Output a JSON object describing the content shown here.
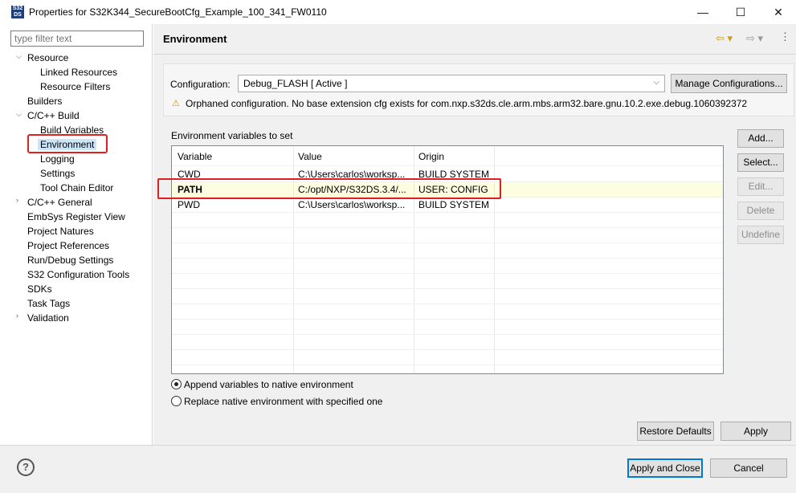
{
  "window": {
    "icon_text": "S32 DS",
    "title": "Properties for S32K344_SecureBootCfg_Example_100_341_FW0110",
    "minimize": "—",
    "maximize": "☐",
    "close": "✕"
  },
  "sidebar": {
    "filter_placeholder": "type filter text",
    "items": [
      {
        "label": "Resource",
        "arrow": "v"
      },
      {
        "label": "Linked Resources"
      },
      {
        "label": "Resource Filters"
      },
      {
        "label": "Builders"
      },
      {
        "label": "C/C++ Build",
        "arrow": "v"
      },
      {
        "label": "Build Variables"
      },
      {
        "label": "Environment"
      },
      {
        "label": "Logging"
      },
      {
        "label": "Settings"
      },
      {
        "label": "Tool Chain Editor"
      },
      {
        "label": "C/C++ General",
        "arrow": ">"
      },
      {
        "label": "EmbSys Register View"
      },
      {
        "label": "Project Natures"
      },
      {
        "label": "Project References"
      },
      {
        "label": "Run/Debug Settings"
      },
      {
        "label": "S32 Configuration Tools"
      },
      {
        "label": "SDKs"
      },
      {
        "label": "Task Tags"
      },
      {
        "label": "Validation",
        "arrow": ">"
      }
    ]
  },
  "main": {
    "title": "Environment",
    "nav_back": "⇦ ▾",
    "nav_forward": "⇨ ▾",
    "nav_menu": "⋮",
    "configuration_label": "Configuration:",
    "configuration_value": "Debug_FLASH  [ Active ]",
    "manage_button": "Manage Configurations...",
    "warning": "Orphaned configuration. No base extension cfg exists for com.nxp.s32ds.cle.arm.mbs.arm32.bare.gnu.10.2.exe.debug.1060392372",
    "env_label": "Environment variables to set",
    "table": {
      "headers": [
        "Variable",
        "Value",
        "Origin"
      ],
      "rows": [
        {
          "variable": "CWD",
          "value": "C:\\Users\\carlos\\worksp...",
          "origin": "BUILD SYSTEM"
        },
        {
          "variable": "PATH",
          "value": "C:/opt/NXP/S32DS.3.4/...",
          "origin": "USER: CONFIG"
        },
        {
          "variable": "PWD",
          "value": "C:\\Users\\carlos\\worksp...",
          "origin": "BUILD SYSTEM"
        }
      ]
    },
    "side_buttons": {
      "add": "Add...",
      "select": "Select...",
      "edit": "Edit...",
      "delete": "Delete",
      "undefine": "Undefine"
    },
    "radio_append": "Append variables to native environment",
    "radio_replace": "Replace native environment with specified one",
    "restore_defaults": "Restore Defaults",
    "apply": "Apply"
  },
  "footer": {
    "help": "?",
    "apply_close": "Apply and Close",
    "cancel": "Cancel"
  }
}
